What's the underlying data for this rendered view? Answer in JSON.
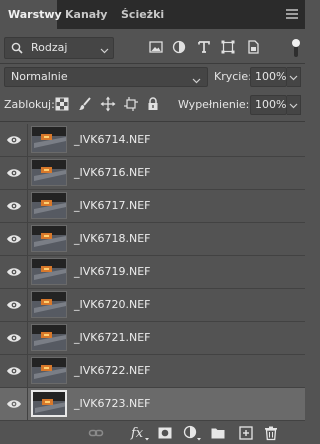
{
  "tabs": [
    {
      "label": "Warstwy",
      "active": true
    },
    {
      "label": "Kanały",
      "active": false
    },
    {
      "label": "Ścieżki",
      "active": false
    }
  ],
  "filter": {
    "kind_label": "Rodzaj"
  },
  "blend": {
    "mode": "Normalnie",
    "opacity_label": "Krycie:",
    "opacity_value": "100%"
  },
  "lock": {
    "label": "Zablokuj:",
    "fill_label": "Wypełnienie:",
    "fill_value": "100%"
  },
  "layers": [
    {
      "name": "_IVK6714.NEF",
      "visible": true,
      "selected": false
    },
    {
      "name": "_IVK6716.NEF",
      "visible": true,
      "selected": false
    },
    {
      "name": "_IVK6717.NEF",
      "visible": true,
      "selected": false
    },
    {
      "name": "_IVK6718.NEF",
      "visible": true,
      "selected": false
    },
    {
      "name": "_IVK6719.NEF",
      "visible": true,
      "selected": false
    },
    {
      "name": "_IVK6720.NEF",
      "visible": true,
      "selected": false
    },
    {
      "name": "_IVK6721.NEF",
      "visible": true,
      "selected": false
    },
    {
      "name": "_IVK6722.NEF",
      "visible": true,
      "selected": false
    },
    {
      "name": "_IVK6723.NEF",
      "visible": true,
      "selected": true
    }
  ],
  "colors": {
    "panel": "#535353",
    "tabbar": "#2b2b2b",
    "selected": "#6a6a6a",
    "field": "#454545"
  },
  "icons": [
    "search-icon",
    "image-filter-icon",
    "adjustment-filter-icon",
    "type-filter-icon",
    "shape-filter-icon",
    "smart-object-filter-icon",
    "filter-toggle",
    "lock-transparent-icon",
    "lock-image-icon",
    "lock-position-icon",
    "lock-artboard-icon",
    "lock-all-icon",
    "eye-icon",
    "link-icon",
    "fx-icon",
    "mask-icon",
    "adjustment-layer-icon",
    "group-folder-icon",
    "new-layer-icon",
    "trash-icon"
  ]
}
